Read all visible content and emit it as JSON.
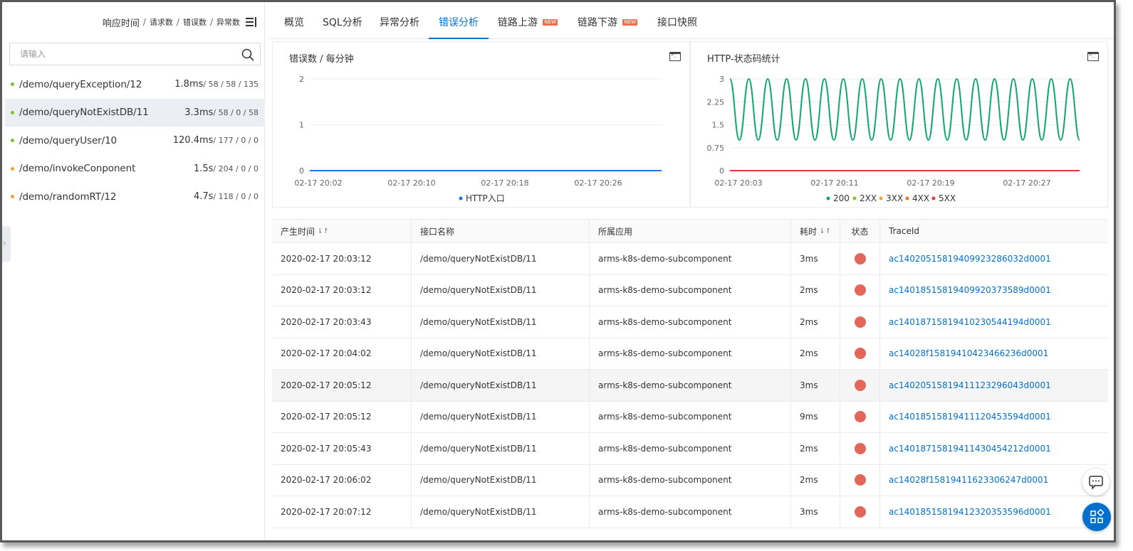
{
  "left": {
    "header": {
      "response_time": "响应时间",
      "sep": "/",
      "requests": "请求数",
      "errors": "错误数",
      "exceptions": "异常数"
    },
    "search_placeholder": "请输入",
    "items": [
      {
        "path": "/demo/queryException/12",
        "time": "1.8ms",
        "counts": "/ 58 / 58 / 135",
        "dot": "#7cc427",
        "selected": false
      },
      {
        "path": "/demo/queryNotExistDB/11",
        "time": "3.3ms",
        "counts": "/ 58 / 0 / 58",
        "dot": "#7cc427",
        "selected": true
      },
      {
        "path": "/demo/queryUser/10",
        "time": "120.4ms",
        "counts": "/ 177 / 0 / 0",
        "dot": "#7cc427",
        "selected": false
      },
      {
        "path": "/demo/invokeConponent",
        "time": "1.5s",
        "counts": "/ 204 / 0 / 0",
        "dot": "#f0a32f",
        "selected": false
      },
      {
        "path": "/demo/randomRT/12",
        "time": "4.7s",
        "counts": "/ 118 / 0 / 0",
        "dot": "#f0a32f",
        "selected": false
      }
    ]
  },
  "tabs": [
    {
      "label": "概览",
      "active": false,
      "new": false
    },
    {
      "label": "SQL分析",
      "active": false,
      "new": false
    },
    {
      "label": "异常分析",
      "active": false,
      "new": false
    },
    {
      "label": "错误分析",
      "active": true,
      "new": false
    },
    {
      "label": "链路上游",
      "active": false,
      "new": true
    },
    {
      "label": "链路下游",
      "active": false,
      "new": true
    },
    {
      "label": "接口快照",
      "active": false,
      "new": false
    }
  ],
  "new_badge": "NEW",
  "colors": {
    "accent": "#0070cc",
    "error": "#e2665a",
    "green": "#11a86b"
  },
  "chart_data": [
    {
      "type": "line",
      "title": "错误数 / 每分钟",
      "ylim": [
        0,
        2
      ],
      "yticks": [
        "0",
        "1",
        "2"
      ],
      "xticks": [
        "02-17 20:02",
        "02-17 20:10",
        "02-17 20:18",
        "02-17 20:26"
      ],
      "series": [
        {
          "name": "HTTP入口",
          "color": "#1a75e8",
          "values": [
            0,
            0
          ]
        }
      ],
      "legend": "bottom"
    },
    {
      "type": "line",
      "title": "HTTP-状态码统计",
      "ylim": [
        0,
        3
      ],
      "yticks": [
        "0",
        "0.75",
        "1.5",
        "2.25",
        "3"
      ],
      "xticks": [
        "02-17 20:03",
        "02-17 20:11",
        "02-17 20:19",
        "02-17 20:27"
      ],
      "series": [
        {
          "name": "200",
          "color": "#11a86b",
          "values": [
            3,
            1,
            3,
            1,
            3,
            1,
            3,
            1,
            3,
            1,
            3,
            1,
            3,
            1,
            3,
            1,
            3,
            1,
            3,
            1,
            3,
            1,
            3,
            1,
            3,
            1,
            3,
            1,
            3,
            1,
            3,
            1,
            3,
            1,
            3,
            1,
            3,
            1
          ]
        },
        {
          "name": "2XX",
          "color": "#7cc427",
          "values": [
            0,
            0
          ]
        },
        {
          "name": "3XX",
          "color": "#f0a32f",
          "values": [
            0,
            0
          ]
        },
        {
          "name": "4XX",
          "color": "#f5731e",
          "values": [
            0,
            0
          ]
        },
        {
          "name": "5XX",
          "color": "#e23b35",
          "values": [
            0,
            0
          ]
        }
      ],
      "legend": "bottom"
    }
  ],
  "table": {
    "headers": [
      "产生时间",
      "接口名称",
      "所属应用",
      "耗时",
      "状态",
      "TraceId"
    ],
    "sort_icon": "⇂↾",
    "rows": [
      {
        "time": "2020-02-17 20:03:12",
        "api": "/demo/queryNotExistDB/11",
        "app": "arms-k8s-demo-subcomponent",
        "cost": "3ms",
        "trace": "ac14020515819409923286032d0001"
      },
      {
        "time": "2020-02-17 20:03:12",
        "api": "/demo/queryNotExistDB/11",
        "app": "arms-k8s-demo-subcomponent",
        "cost": "2ms",
        "trace": "ac14018515819409920373589d0001"
      },
      {
        "time": "2020-02-17 20:03:43",
        "api": "/demo/queryNotExistDB/11",
        "app": "arms-k8s-demo-subcomponent",
        "cost": "2ms",
        "trace": "ac14018715819410230544194d0001"
      },
      {
        "time": "2020-02-17 20:04:02",
        "api": "/demo/queryNotExistDB/11",
        "app": "arms-k8s-demo-subcomponent",
        "cost": "2ms",
        "trace": "ac14028f15819410423466236d0001"
      },
      {
        "time": "2020-02-17 20:05:12",
        "api": "/demo/queryNotExistDB/11",
        "app": "arms-k8s-demo-subcomponent",
        "cost": "3ms",
        "trace": "ac14020515819411123296043d0001"
      },
      {
        "time": "2020-02-17 20:05:12",
        "api": "/demo/queryNotExistDB/11",
        "app": "arms-k8s-demo-subcomponent",
        "cost": "9ms",
        "trace": "ac14018515819411120453594d0001"
      },
      {
        "time": "2020-02-17 20:05:43",
        "api": "/demo/queryNotExistDB/11",
        "app": "arms-k8s-demo-subcomponent",
        "cost": "2ms",
        "trace": "ac14018715819411430454212d0001"
      },
      {
        "time": "2020-02-17 20:06:02",
        "api": "/demo/queryNotExistDB/11",
        "app": "arms-k8s-demo-subcomponent",
        "cost": "2ms",
        "trace": "ac14028f15819411623306247d0001"
      },
      {
        "time": "2020-02-17 20:07:12",
        "api": "/demo/queryNotExistDB/11",
        "app": "arms-k8s-demo-subcomponent",
        "cost": "3ms",
        "trace": "ac14018515819412320353596d0001"
      }
    ]
  }
}
